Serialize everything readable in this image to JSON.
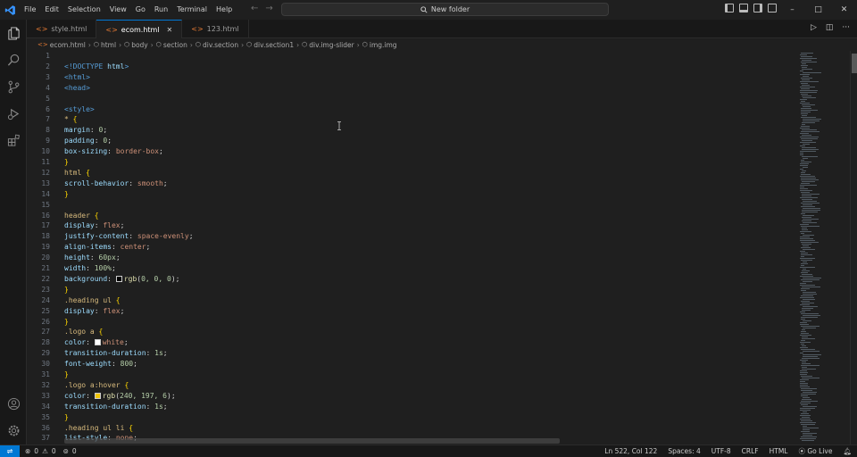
{
  "menu": [
    "File",
    "Edit",
    "Selection",
    "View",
    "Go",
    "Run",
    "Terminal",
    "Help"
  ],
  "command_center": {
    "label": "New folder"
  },
  "window_controls": {
    "minimize": "–",
    "maximize": "□",
    "close": "✕"
  },
  "tabs": [
    {
      "label": "style.html",
      "active": false
    },
    {
      "label": "ecom.html",
      "active": true
    },
    {
      "label": "123.html",
      "active": false
    }
  ],
  "breadcrumb": [
    "ecom.html",
    "html",
    "body",
    "section",
    "div.section",
    "div.section1",
    "div.img-slider",
    "img.img"
  ],
  "code_lines": [
    {
      "n": "1",
      "parts": []
    },
    {
      "n": "2",
      "parts": [
        [
          "c-tag",
          "<!DOCTYPE "
        ],
        [
          "c-prop",
          "html"
        ],
        [
          "c-tag",
          ">"
        ]
      ]
    },
    {
      "n": "3",
      "parts": [
        [
          "c-tag",
          "<html>"
        ]
      ]
    },
    {
      "n": "4",
      "parts": [
        [
          "c-tag",
          "<head>"
        ]
      ]
    },
    {
      "n": "5",
      "parts": []
    },
    {
      "n": "6",
      "parts": [
        [
          "c-tag",
          "<style>"
        ]
      ]
    },
    {
      "n": "7",
      "parts": [
        [
          "c-sel",
          "* "
        ],
        [
          "c-brk",
          "{"
        ]
      ]
    },
    {
      "n": "8",
      "parts": [
        [
          "c-prop",
          "margin"
        ],
        [
          "c-pun",
          ": "
        ],
        [
          "c-num",
          "0"
        ],
        [
          "c-pun",
          ";"
        ]
      ]
    },
    {
      "n": "9",
      "parts": [
        [
          "c-prop",
          "padding"
        ],
        [
          "c-pun",
          ": "
        ],
        [
          "c-num",
          "0"
        ],
        [
          "c-pun",
          ";"
        ]
      ]
    },
    {
      "n": "10",
      "parts": [
        [
          "c-prop",
          "box-sizing"
        ],
        [
          "c-pun",
          ": "
        ],
        [
          "c-val",
          "border-box"
        ],
        [
          "c-pun",
          ";"
        ]
      ]
    },
    {
      "n": "11",
      "parts": [
        [
          "c-brk",
          "}"
        ]
      ]
    },
    {
      "n": "12",
      "parts": [
        [
          "c-sel",
          "html "
        ],
        [
          "c-brk",
          "{"
        ]
      ]
    },
    {
      "n": "13",
      "parts": [
        [
          "c-prop",
          "scroll-behavior"
        ],
        [
          "c-pun",
          ": "
        ],
        [
          "c-val",
          "smooth"
        ],
        [
          "c-pun",
          ";"
        ]
      ]
    },
    {
      "n": "14",
      "parts": [
        [
          "c-brk",
          "}"
        ]
      ]
    },
    {
      "n": "15",
      "parts": []
    },
    {
      "n": "16",
      "parts": [
        [
          "c-sel",
          "header "
        ],
        [
          "c-brk",
          "{"
        ]
      ]
    },
    {
      "n": "17",
      "parts": [
        [
          "c-prop",
          "display"
        ],
        [
          "c-pun",
          ": "
        ],
        [
          "c-val",
          "flex"
        ],
        [
          "c-pun",
          ";"
        ]
      ]
    },
    {
      "n": "18",
      "parts": [
        [
          "c-prop",
          "justify-content"
        ],
        [
          "c-pun",
          ": "
        ],
        [
          "c-val",
          "space-evenly"
        ],
        [
          "c-pun",
          ";"
        ]
      ]
    },
    {
      "n": "19",
      "parts": [
        [
          "c-prop",
          "align-items"
        ],
        [
          "c-pun",
          ": "
        ],
        [
          "c-val",
          "center"
        ],
        [
          "c-pun",
          ";"
        ]
      ]
    },
    {
      "n": "20",
      "parts": [
        [
          "c-prop",
          "height"
        ],
        [
          "c-pun",
          ": "
        ],
        [
          "c-num",
          "60px"
        ],
        [
          "c-pun",
          ";"
        ]
      ]
    },
    {
      "n": "21",
      "parts": [
        [
          "c-prop",
          "width"
        ],
        [
          "c-pun",
          ": "
        ],
        [
          "c-num",
          "100%"
        ],
        [
          "c-pun",
          ";"
        ]
      ]
    },
    {
      "n": "22",
      "parts": [
        [
          "c-prop",
          "background"
        ],
        [
          "c-pun",
          ": "
        ],
        [
          "swatch",
          "#000000"
        ],
        [
          "c-fn",
          "rgb"
        ],
        [
          "c-pun",
          "("
        ],
        [
          "c-num",
          "0, 0, 0"
        ],
        [
          "c-pun",
          ");"
        ]
      ]
    },
    {
      "n": "23",
      "parts": [
        [
          "c-brk",
          "}"
        ]
      ]
    },
    {
      "n": "24",
      "parts": [
        [
          "c-sel",
          ".heading ul "
        ],
        [
          "c-brk",
          "{"
        ]
      ]
    },
    {
      "n": "25",
      "parts": [
        [
          "c-prop",
          "display"
        ],
        [
          "c-pun",
          ": "
        ],
        [
          "c-val",
          "flex"
        ],
        [
          "c-pun",
          ";"
        ]
      ]
    },
    {
      "n": "26",
      "parts": [
        [
          "c-brk",
          "}"
        ]
      ]
    },
    {
      "n": "27",
      "parts": [
        [
          "c-sel",
          ".logo a "
        ],
        [
          "c-brk",
          "{"
        ]
      ]
    },
    {
      "n": "28",
      "parts": [
        [
          "c-prop",
          "color"
        ],
        [
          "c-pun",
          ": "
        ],
        [
          "swatch",
          "#ffffff"
        ],
        [
          "c-val",
          "white"
        ],
        [
          "c-pun",
          ";"
        ]
      ]
    },
    {
      "n": "29",
      "parts": [
        [
          "c-prop",
          "transition-duration"
        ],
        [
          "c-pun",
          ": "
        ],
        [
          "c-num",
          "1s"
        ],
        [
          "c-pun",
          ";"
        ]
      ]
    },
    {
      "n": "30",
      "parts": [
        [
          "c-prop",
          "font-weight"
        ],
        [
          "c-pun",
          ": "
        ],
        [
          "c-num",
          "800"
        ],
        [
          "c-pun",
          ";"
        ]
      ]
    },
    {
      "n": "31",
      "parts": [
        [
          "c-brk",
          "}"
        ]
      ]
    },
    {
      "n": "32",
      "parts": [
        [
          "c-sel",
          ".logo a:hover "
        ],
        [
          "c-brk",
          "{"
        ]
      ]
    },
    {
      "n": "33",
      "parts": [
        [
          "c-prop",
          "color"
        ],
        [
          "c-pun",
          ": "
        ],
        [
          "swatch",
          "#f0c506"
        ],
        [
          "c-fn",
          "rgb"
        ],
        [
          "c-pun",
          "("
        ],
        [
          "c-num",
          "240, 197, 6"
        ],
        [
          "c-pun",
          ");"
        ]
      ]
    },
    {
      "n": "34",
      "parts": [
        [
          "c-prop",
          "transition-duration"
        ],
        [
          "c-pun",
          ": "
        ],
        [
          "c-num",
          "1s"
        ],
        [
          "c-pun",
          ";"
        ]
      ]
    },
    {
      "n": "35",
      "parts": [
        [
          "c-brk",
          "}"
        ]
      ]
    },
    {
      "n": "36",
      "parts": [
        [
          "c-sel",
          ".heading ul li "
        ],
        [
          "c-brk",
          "{"
        ]
      ]
    },
    {
      "n": "37",
      "parts": [
        [
          "c-prop",
          "list-style"
        ],
        [
          "c-pun",
          ": "
        ],
        [
          "c-val",
          "none"
        ],
        [
          "c-pun",
          ";"
        ]
      ]
    }
  ],
  "status": {
    "errors": "0",
    "warnings": "0",
    "ports": "0",
    "position": "Ln 522, Col 122",
    "spaces": "Spaces: 4",
    "encoding": "UTF-8",
    "eol": "CRLF",
    "language": "HTML",
    "golive": "Go Live"
  },
  "colors": {
    "accent": "#0078d4",
    "tab_html_icon": "#e37933"
  },
  "icons": {
    "activity": [
      "explorer-icon",
      "search-icon",
      "source-control-icon",
      "run-debug-icon",
      "extensions-icon",
      "account-icon",
      "settings-gear-icon"
    ]
  }
}
